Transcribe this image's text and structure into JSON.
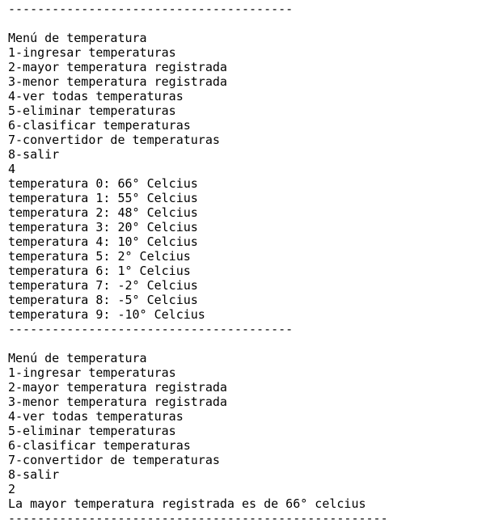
{
  "console": {
    "lines": [
      "---------------------------------------",
      "",
      "Menú de temperatura",
      "1-ingresar temperaturas",
      "2-mayor temperatura registrada",
      "3-menor temperatura registrada",
      "4-ver todas temperaturas",
      "5-eliminar temperaturas",
      "6-clasificar temperaturas",
      "7-convertidor de temperaturas",
      "8-salir",
      "4",
      "temperatura 0: 66° Celcius",
      "temperatura 1: 55° Celcius",
      "temperatura 2: 48° Celcius",
      "temperatura 3: 20° Celcius",
      "temperatura 4: 10° Celcius",
      "temperatura 5: 2° Celcius",
      "temperatura 6: 1° Celcius",
      "temperatura 7: -2° Celcius",
      "temperatura 8: -5° Celcius",
      "temperatura 9: -10° Celcius",
      "---------------------------------------",
      "",
      "Menú de temperatura",
      "1-ingresar temperaturas",
      "2-mayor temperatura registrada",
      "3-menor temperatura registrada",
      "4-ver todas temperaturas",
      "5-eliminar temperaturas",
      "6-clasificar temperaturas",
      "7-convertidor de temperaturas",
      "8-salir",
      "2",
      "La mayor temperatura registrada es de 66° celcius",
      "----------------------------------------------------"
    ]
  }
}
